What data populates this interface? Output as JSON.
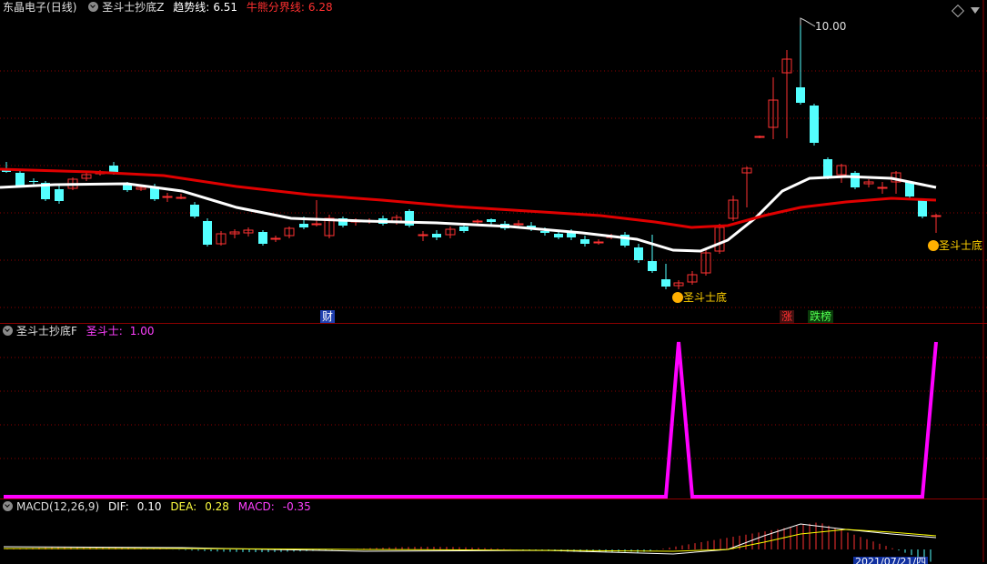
{
  "main": {
    "title": "东晶电子",
    "period": "(日线)",
    "indicator": "圣斗士抄底Z",
    "trend_label": "趋势线:",
    "trend_value": "6.51",
    "bullbear_label": "牛熊分界线:",
    "bullbear_value": "6.28",
    "high_label": "10.00",
    "signal_label": "圣斗士底",
    "tag_cai": "财",
    "tag_zhang": "涨",
    "tag_dieban": "跌榜"
  },
  "sub1": {
    "indicator": "圣斗士抄底F",
    "label": "圣斗士:",
    "value": "1.00"
  },
  "macd": {
    "indicator": "MACD(12,26,9)",
    "dif_label": "DIF:",
    "dif_value": "0.10",
    "dea_label": "DEA:",
    "dea_value": "0.28",
    "macd_label": "MACD:",
    "macd_value": "-0.35",
    "date_fragment": "2021/07/21/四"
  },
  "colors": {
    "up": "#ff3232",
    "down": "#54ffff",
    "trend": "#ffffff",
    "bullbear": "#e00000",
    "signal": "#ff00ff",
    "dea": "#ffff00",
    "grid": "#8b0000"
  },
  "icons": [
    "expand-diamond-icon",
    "collapse-circle-icon",
    "signal-arrow-icon"
  ]
}
